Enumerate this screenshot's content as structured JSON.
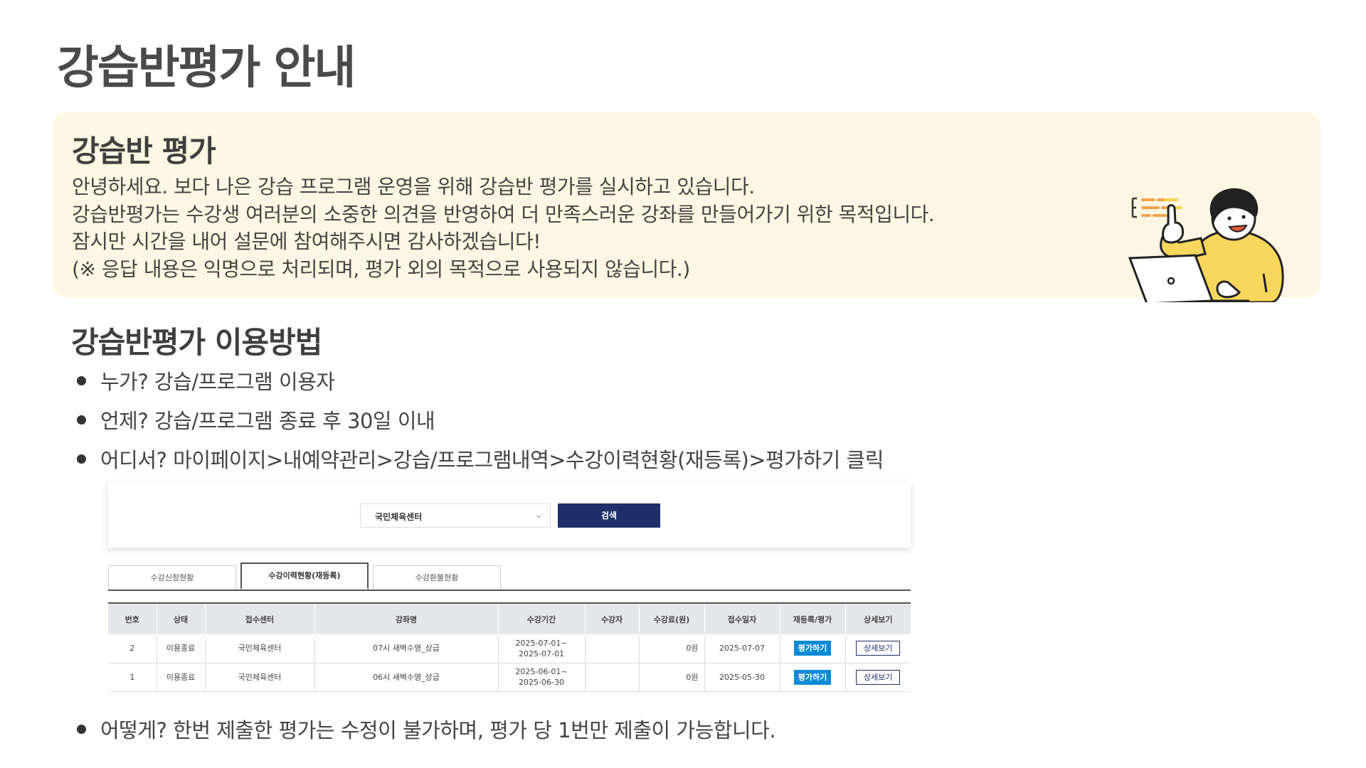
{
  "page": {
    "title": "강습반평가 안내"
  },
  "notice": {
    "title": "강습반 평가",
    "lines": [
      "안녕하세요. 보다 나은 강습 프로그램 운영을 위해 강습반 평가를 실시하고 있습니다.",
      "강습반평가는 수강생 여러분의 소중한 의견을 반영하여 더 만족스러운 강좌를 만들어가기 위한 목적입니다.",
      "잠시만 시간을 내어 설문에 참여해주시면 감사하겠습니다!",
      "(※ 응답 내용은 익명으로 처리되며, 평가 외의 목적으로 사용되지 않습니다.)"
    ]
  },
  "usage": {
    "title": "강습반평가 이용방법",
    "bullets": [
      "누가? 강습/프로그램 이용자",
      "언제? 강습/프로그램 종료 후 30일 이내",
      "어디서? 마이페이지>내예약관리>강습/프로그램내역>수강이력현황(재등록)>평가하기 클릭",
      "어떻게? 한번 제출한 평가는 수정이 불가하며, 평가 당 1번만 제출이 가능합니다."
    ]
  },
  "screenshot": {
    "select_value": "국민체육센터",
    "search_label": "검색",
    "tabs": [
      "수강신청현황",
      "수강이력현황(재등록)",
      "수강환불현황"
    ],
    "active_tab": "수강이력현황(재등록)",
    "columns": [
      "번호",
      "상태",
      "접수센터",
      "강좌명",
      "수강기간",
      "수강자",
      "수강료(원)",
      "접수일자",
      "재등록/평가",
      "상세보기"
    ],
    "rows": [
      {
        "no": "2",
        "status": "이용종료",
        "center": "국민체육센터",
        "course": "07시 새벽수영_상급",
        "period_start": "2025-07-01~",
        "period_end": "2025-07-01",
        "student": "",
        "fee": "0원",
        "date": "2025-07-07",
        "eval": "평가하기",
        "detail": "상세보기"
      },
      {
        "no": "1",
        "status": "이용종료",
        "center": "국민체육센터",
        "course": "06시 새벽수영_상급",
        "period_start": "2025-06-01~",
        "period_end": "2025-06-30",
        "student": "",
        "fee": "0원",
        "date": "2025-05-30",
        "eval": "평가하기",
        "detail": "상세보기"
      }
    ]
  },
  "icons": {
    "illustration": "person-with-laptop-pointing-icon",
    "chevron": "chevron-down-icon"
  },
  "colors": {
    "notice_bg": "#fff7e3",
    "accent_navy": "#1f2f6b",
    "eval_blue": "#0b8bd6",
    "shirt_yellow": "#f9d65c"
  }
}
